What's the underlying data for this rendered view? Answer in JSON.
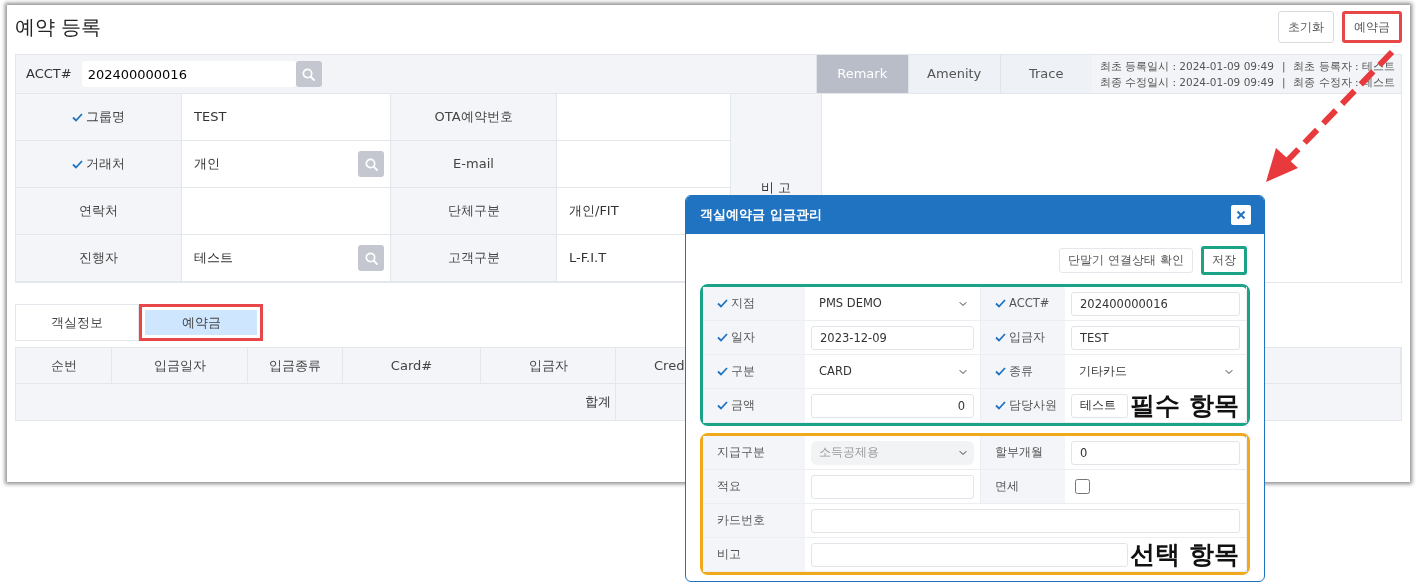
{
  "page": {
    "title": "예약 등록",
    "buttons": [
      {
        "label": "초기화",
        "highlighted": false
      },
      {
        "label": "예약금",
        "highlighted": true
      }
    ]
  },
  "account": {
    "label": "ACCT#",
    "value": "202400000016"
  },
  "side_tabs": [
    {
      "label": "Remark",
      "selected": true
    },
    {
      "label": "Amenity",
      "selected": false
    },
    {
      "label": "Trace",
      "selected": false
    }
  ],
  "audit": [
    {
      "date": "최초 등록일시 : 2024-01-09 09:49",
      "separator": "|",
      "user": "최초 등록자 : 테스트"
    },
    {
      "date": "최종 수정일시 : 2024-01-09 09:49",
      "separator": "|",
      "user": "최종 수정자 : 테스트"
    }
  ],
  "form": [
    [
      {
        "label": "그룹명",
        "required": true,
        "value": "TEST",
        "search": false
      },
      {
        "label": "OTA예약번호",
        "required": false
      }
    ],
    [
      {
        "label": "거래처",
        "required": true,
        "value": "개인",
        "search": true
      },
      {
        "label": "E-mail",
        "required": false
      }
    ],
    [
      {
        "label": "연락처",
        "required": false,
        "search": false
      },
      {
        "label": "단체구분",
        "required": false,
        "value": "개인/FIT"
      }
    ],
    [
      {
        "label": "진행자",
        "required": false,
        "value": "테스트",
        "search": true
      },
      {
        "label": "고객구분",
        "required": false,
        "value": "L-F.I.T"
      }
    ]
  ],
  "remark_label": "비 고",
  "bottom_tabs": [
    {
      "label": "객실정보",
      "selected": false,
      "highlighted": false
    },
    {
      "label": "예약금",
      "selected": true,
      "highlighted": true
    }
  ],
  "deposit_table": {
    "columns": [
      "순번",
      "입금일자",
      "입금종류",
      "Card#",
      "입금자",
      "Cred"
    ],
    "total_label": "합계"
  },
  "modal": {
    "title": "객실예약금 입금관리",
    "buttons": [
      {
        "label": "단말기 연결상태 확인",
        "highlighted": false
      },
      {
        "label": "저장",
        "highlighted": true
      }
    ],
    "sections": [
      {
        "annotation": "필수 항목",
        "color": "#1aa387",
        "rows": [
          [
            {
              "label": "지점",
              "required": true,
              "kind": "select",
              "value": "PMS DEMO",
              "disabled": false
            },
            {
              "label": "ACCT#",
              "required": true,
              "kind": "input",
              "value": "202400000016"
            }
          ],
          [
            {
              "label": "일자",
              "required": true,
              "kind": "input",
              "value": "2023-12-09"
            },
            {
              "label": "입금자",
              "required": true,
              "kind": "input",
              "value": "TEST"
            }
          ],
          [
            {
              "label": "구분",
              "required": true,
              "kind": "select",
              "value": "CARD",
              "disabled": false
            },
            {
              "label": "종류",
              "required": true,
              "kind": "select",
              "value": "기타카드",
              "disabled": false
            }
          ],
          [
            {
              "label": "금액",
              "required": true,
              "kind": "number",
              "value": "0"
            },
            {
              "label": "담당사원",
              "required": true,
              "kind": "input",
              "value": "테스트"
            }
          ]
        ]
      },
      {
        "annotation": "선택 항목",
        "color": "#f0a91b",
        "rows": [
          [
            {
              "label": "지급구분",
              "required": false,
              "kind": "select",
              "value": "소득공제용",
              "disabled": true
            },
            {
              "label": "할부개월",
              "required": false,
              "kind": "input",
              "value": "0"
            }
          ],
          [
            {
              "label": "적요",
              "required": false,
              "kind": "input"
            },
            {
              "label": "면세",
              "required": false,
              "kind": "checkbox",
              "checked": false
            }
          ],
          [
            {
              "label": "카드번호",
              "required": false,
              "kind": "input"
            }
          ],
          [
            {
              "label": "비고",
              "required": false,
              "kind": "input"
            }
          ]
        ]
      }
    ]
  }
}
